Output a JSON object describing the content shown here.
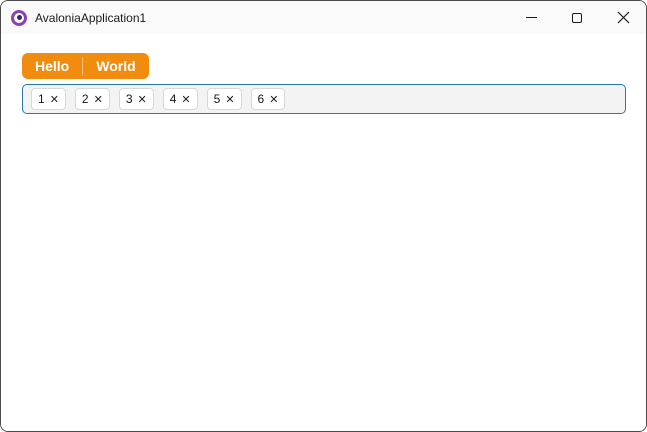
{
  "window": {
    "title": "AvaloniaApplication1",
    "controls": {
      "minimize_icon": "dash",
      "maximize_icon": "square-outline",
      "close_icon": "x"
    }
  },
  "tabs": [
    {
      "label": "Hello"
    },
    {
      "label": "World"
    }
  ],
  "chips": {
    "items": [
      {
        "value": "1"
      },
      {
        "value": "2"
      },
      {
        "value": "3"
      },
      {
        "value": "4"
      },
      {
        "value": "5"
      },
      {
        "value": "6"
      }
    ],
    "remove_glyph": "✕"
  },
  "colors": {
    "accent": "#F28C0E",
    "input-border": "#2878AE",
    "input-bg": "#F3F3F3",
    "chip-border": "#D8D8D8",
    "logo-purple": "#8B44AD"
  }
}
